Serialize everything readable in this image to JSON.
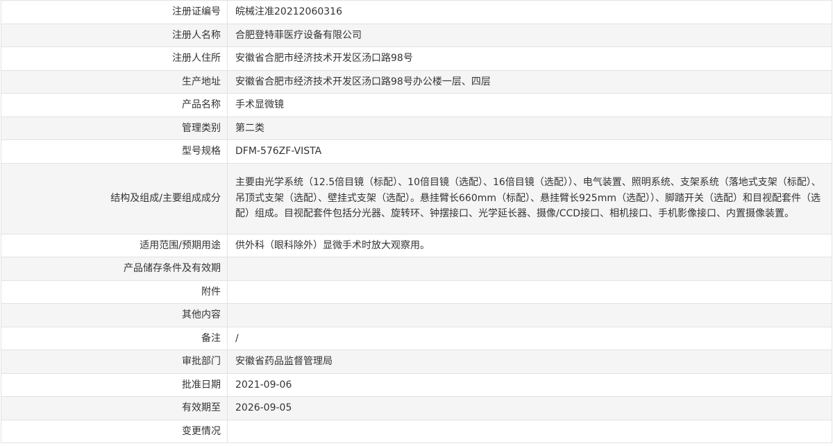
{
  "rows": [
    {
      "label": "注册证编号",
      "value": "皖械注准20212060316"
    },
    {
      "label": "注册人名称",
      "value": "合肥登特菲医疗设备有限公司"
    },
    {
      "label": "注册人住所",
      "value": "安徽省合肥市经济技术开发区汤口路98号"
    },
    {
      "label": "生产地址",
      "value": "安徽省合肥市经济技术开发区汤口路98号办公楼一层、四层"
    },
    {
      "label": "产品名称",
      "value": "手术显微镜"
    },
    {
      "label": "管理类别",
      "value": "第二类"
    },
    {
      "label": "型号规格",
      "value": "DFM-576ZF-VISTA"
    },
    {
      "label": "结构及组成/主要组成成分",
      "value": "主要由光学系统（12.5倍目镜（标配）、10倍目镜（选配）、16倍目镜（选配））、电气装置、照明系统、支架系统（落地式支架（标配）、吊顶式支架（选配）、壁挂式支架（选配）。悬挂臂长660mm（标配）、悬挂臂长925mm（选配））、脚踏开关（选配）和目视配套件（选配）组成。目视配套件包括分光器、旋转环、钟摆接口、光学延长器、摄像/CCD接口、相机接口、手机影像接口、内置摄像装置。"
    },
    {
      "label": "适用范围/预期用途",
      "value": "供外科（眼科除外）显微手术时放大观察用。"
    },
    {
      "label": "产品储存条件及有效期",
      "value": ""
    },
    {
      "label": "附件",
      "value": ""
    },
    {
      "label": "其他内容",
      "value": ""
    },
    {
      "label": "备注",
      "value": "/"
    },
    {
      "label": "审批部门",
      "value": "安徽省药品监督管理局"
    },
    {
      "label": "批准日期",
      "value": "2021-09-06"
    },
    {
      "label": "有效期至",
      "value": "2026-09-05"
    },
    {
      "label": "变更情况",
      "value": ""
    }
  ]
}
